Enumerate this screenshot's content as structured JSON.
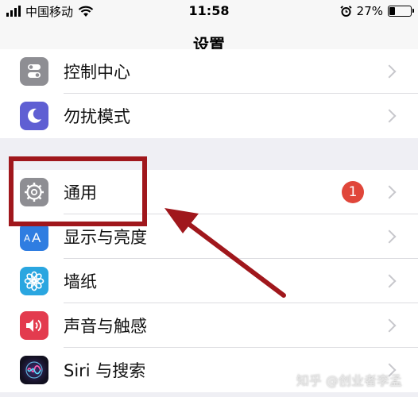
{
  "status_bar": {
    "carrier": "中国移动",
    "time": "11:58",
    "battery_percent": "27%",
    "battery_level": 0.27
  },
  "nav": {
    "title": "设置"
  },
  "group1": [
    {
      "label": "控制中心",
      "icon": "control-center-icon"
    },
    {
      "label": "勿扰模式",
      "icon": "moon-icon"
    }
  ],
  "group2": [
    {
      "label": "通用",
      "icon": "gear-icon",
      "badge": "1"
    },
    {
      "label": "显示与亮度",
      "icon": "text-size-icon"
    },
    {
      "label": "墙纸",
      "icon": "flower-icon"
    },
    {
      "label": "声音与触感",
      "icon": "speaker-icon"
    },
    {
      "label": "Siri 与搜索",
      "icon": "siri-icon"
    }
  ],
  "watermark": "知乎 @创业者李孟",
  "colors": {
    "annotation": "#a0171c",
    "badge": "#e0463a",
    "moon_icon_bg": "#5f5fd3",
    "display_icon_bg": "#2f7de1",
    "wallpaper_icon_bg": "#2aa6e0",
    "sound_icon_bg": "#e33b4e"
  }
}
